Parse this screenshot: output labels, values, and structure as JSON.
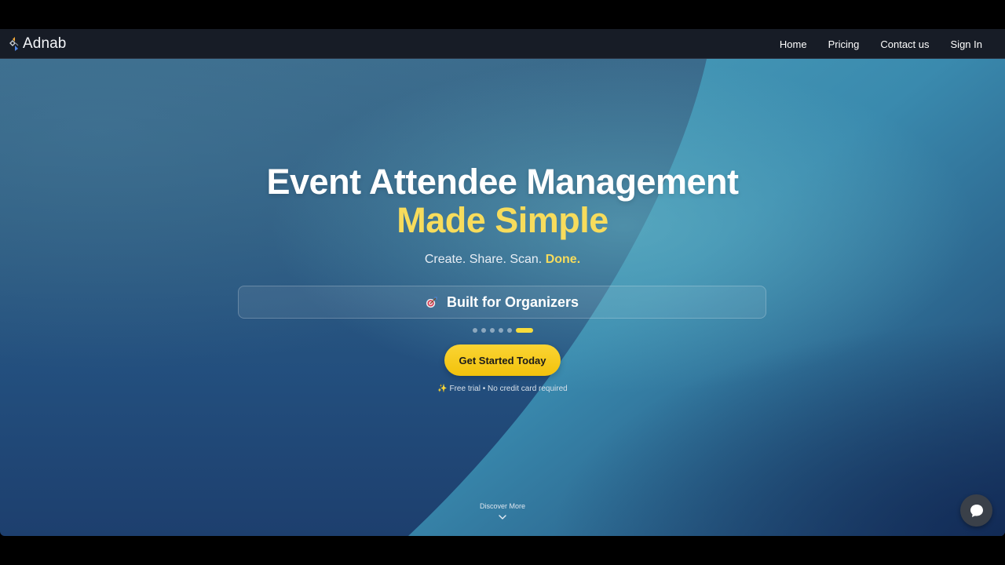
{
  "brand": {
    "name": "Adnab",
    "logo_icon": "adnab-logo-icon"
  },
  "nav": {
    "items": [
      {
        "label": "Home"
      },
      {
        "label": "Pricing"
      },
      {
        "label": "Contact us"
      },
      {
        "label": "Sign In"
      }
    ]
  },
  "hero": {
    "headline_line1": "Event Attendee Management",
    "headline_line2": "Made Simple",
    "tagline_main": "Create. Share. Scan.",
    "tagline_accent": "Done.",
    "feature": {
      "icon": "target-icon",
      "text": "Built for Organizers"
    },
    "carousel": {
      "slide_count": 6,
      "active_index": 5
    },
    "cta_label": "Get Started Today",
    "trial_note": "✨ Free trial • No credit card required",
    "discover_label": "Discover More",
    "discover_icon": "chevron-down-icon"
  },
  "chat": {
    "icon": "chat-bubble-icon"
  },
  "colors": {
    "accent_yellow": "#f7dc5c",
    "cta_yellow": "#f2c20c",
    "navbar": "#171c26",
    "hero_blue": "#2e5c82"
  }
}
